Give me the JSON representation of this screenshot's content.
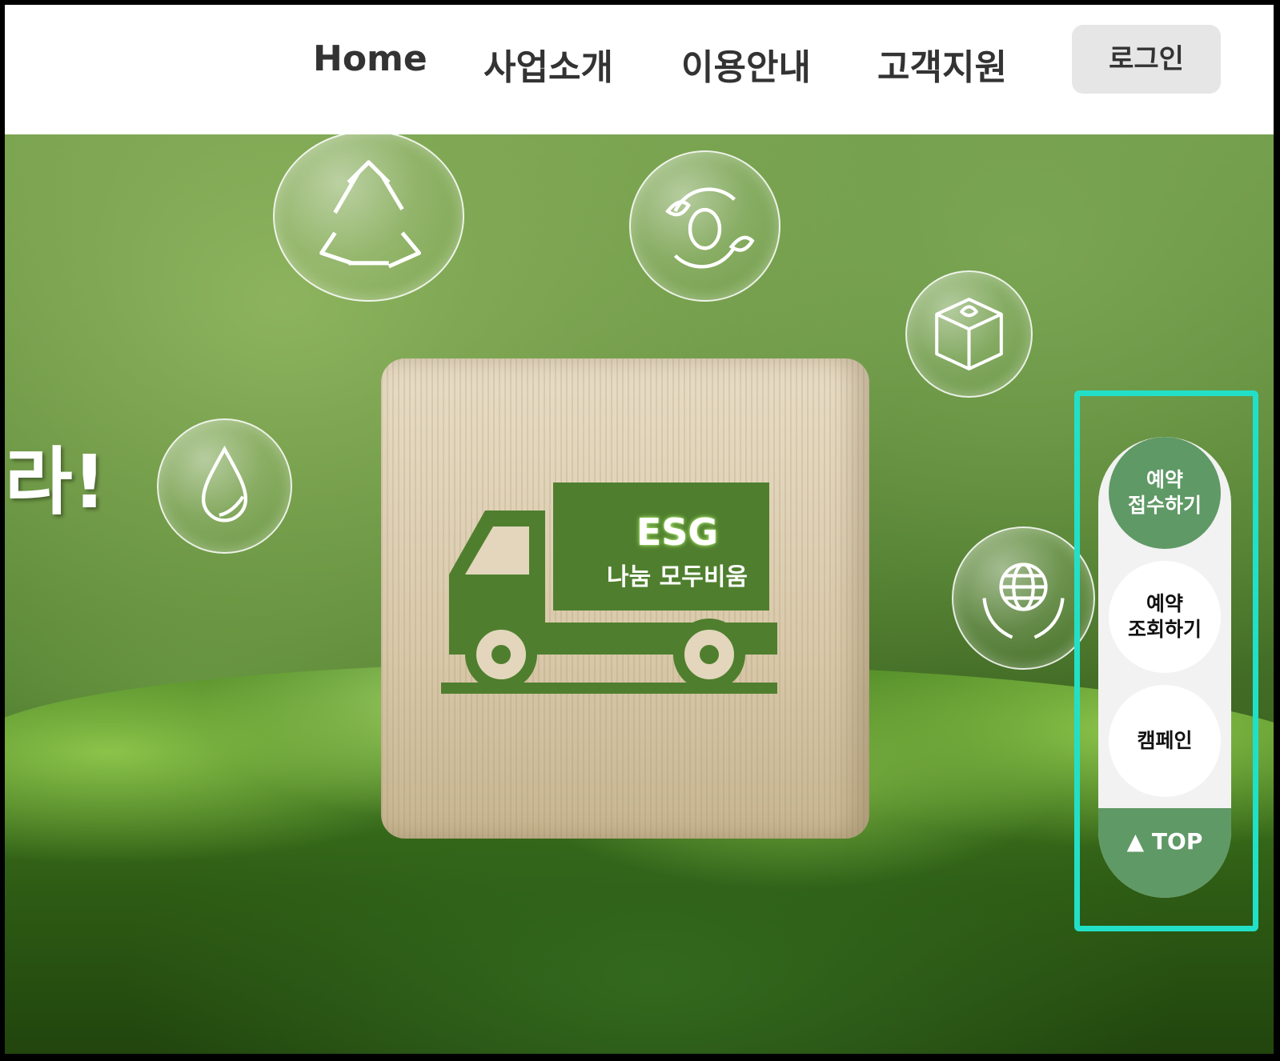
{
  "nav": {
    "items": [
      {
        "label": "Home"
      },
      {
        "label": "사업소개"
      },
      {
        "label": "이용안내"
      },
      {
        "label": "고객지원"
      }
    ],
    "login_label": "로그인"
  },
  "hero": {
    "partial_text": "라!",
    "block": {
      "title": "ESG",
      "subtitle": "나눔 모두비움"
    },
    "bubbles": [
      "recycle-icon",
      "leaf-cycle-icon",
      "eco-cube-icon",
      "water-drop-icon",
      "globe-hands-icon"
    ]
  },
  "quick_menu": {
    "reserve": "예약\n접수하기",
    "lookup": "예약\n조회하기",
    "campaign": "캠페인",
    "top": "▲ TOP"
  },
  "colors": {
    "accent_green": "#5f9966",
    "highlight": "#22e0c8",
    "truck_green": "#4f7f2e"
  }
}
